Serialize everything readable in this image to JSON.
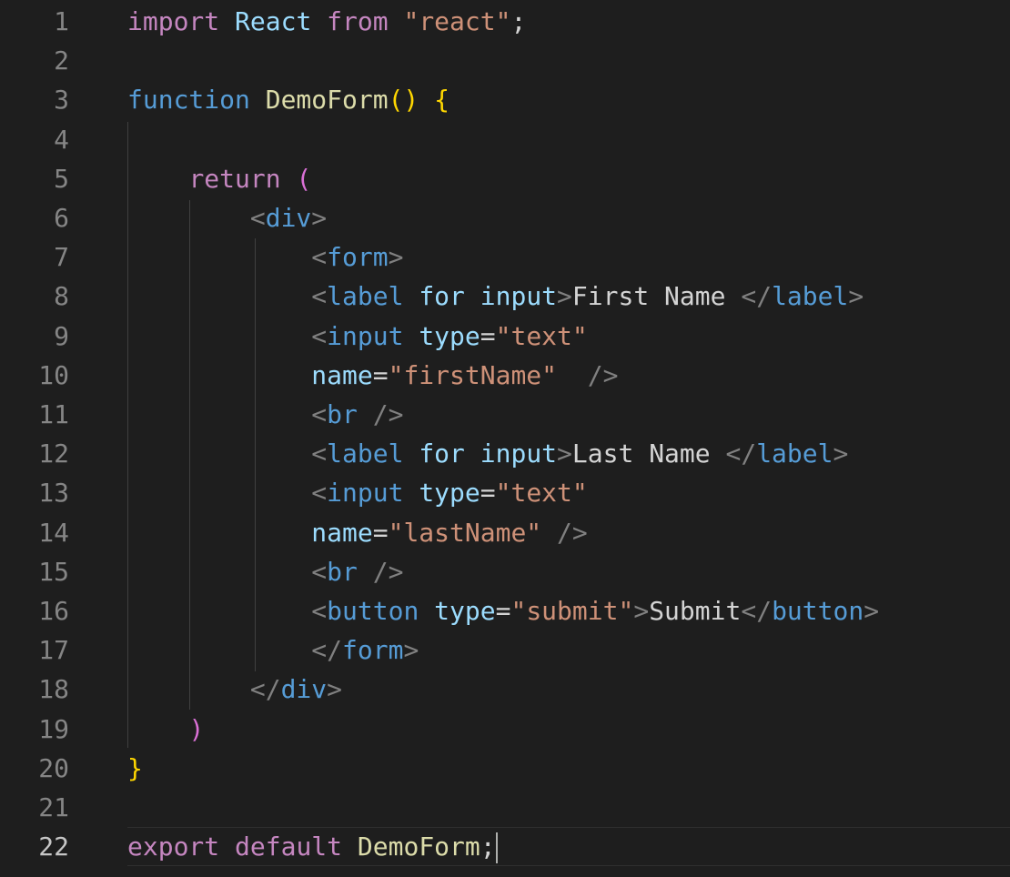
{
  "editor": {
    "current_line": 22,
    "lines": [
      {
        "n": 1,
        "tokens": [
          [
            "kw",
            "import"
          ],
          [
            "pl",
            " "
          ],
          [
            "var",
            "React"
          ],
          [
            "pl",
            " "
          ],
          [
            "kw",
            "from"
          ],
          [
            "pl",
            " "
          ],
          [
            "str",
            "\"react\""
          ],
          [
            "pl",
            ";"
          ]
        ]
      },
      {
        "n": 2,
        "tokens": []
      },
      {
        "n": 3,
        "tokens": [
          [
            "st",
            "function"
          ],
          [
            "pl",
            " "
          ],
          [
            "fn",
            "DemoForm"
          ],
          [
            "br1",
            "()"
          ],
          [
            "pl",
            " "
          ],
          [
            "br1",
            "{"
          ]
        ]
      },
      {
        "n": 4,
        "tokens": []
      },
      {
        "n": 5,
        "tokens": [
          [
            "pl",
            "    "
          ],
          [
            "kw",
            "return"
          ],
          [
            "pl",
            " "
          ],
          [
            "br2",
            "("
          ]
        ]
      },
      {
        "n": 6,
        "tokens": [
          [
            "pl",
            "        "
          ],
          [
            "ang",
            "<"
          ],
          [
            "tag",
            "div"
          ],
          [
            "ang",
            ">"
          ]
        ]
      },
      {
        "n": 7,
        "tokens": [
          [
            "pl",
            "            "
          ],
          [
            "ang",
            "<"
          ],
          [
            "tag",
            "form"
          ],
          [
            "ang",
            ">"
          ]
        ]
      },
      {
        "n": 8,
        "tokens": [
          [
            "pl",
            "            "
          ],
          [
            "ang",
            "<"
          ],
          [
            "tag",
            "label"
          ],
          [
            "pl",
            " "
          ],
          [
            "attr",
            "for"
          ],
          [
            "pl",
            " "
          ],
          [
            "attr",
            "input"
          ],
          [
            "ang",
            ">"
          ],
          [
            "pl",
            "First Name "
          ],
          [
            "ang",
            "</"
          ],
          [
            "tag",
            "label"
          ],
          [
            "ang",
            ">"
          ]
        ]
      },
      {
        "n": 9,
        "tokens": [
          [
            "pl",
            "            "
          ],
          [
            "ang",
            "<"
          ],
          [
            "tag",
            "input"
          ],
          [
            "pl",
            " "
          ],
          [
            "attr",
            "type"
          ],
          [
            "pl",
            "="
          ],
          [
            "str",
            "\"text\""
          ]
        ]
      },
      {
        "n": 10,
        "tokens": [
          [
            "pl",
            "            "
          ],
          [
            "attr",
            "name"
          ],
          [
            "pl",
            "="
          ],
          [
            "str",
            "\"firstName\""
          ],
          [
            "pl",
            "  "
          ],
          [
            "ang",
            "/>"
          ]
        ]
      },
      {
        "n": 11,
        "tokens": [
          [
            "pl",
            "            "
          ],
          [
            "ang",
            "<"
          ],
          [
            "tag",
            "br"
          ],
          [
            "pl",
            " "
          ],
          [
            "ang",
            "/>"
          ]
        ]
      },
      {
        "n": 12,
        "tokens": [
          [
            "pl",
            "            "
          ],
          [
            "ang",
            "<"
          ],
          [
            "tag",
            "label"
          ],
          [
            "pl",
            " "
          ],
          [
            "attr",
            "for"
          ],
          [
            "pl",
            " "
          ],
          [
            "attr",
            "input"
          ],
          [
            "ang",
            ">"
          ],
          [
            "pl",
            "Last Name "
          ],
          [
            "ang",
            "</"
          ],
          [
            "tag",
            "label"
          ],
          [
            "ang",
            ">"
          ]
        ]
      },
      {
        "n": 13,
        "tokens": [
          [
            "pl",
            "            "
          ],
          [
            "ang",
            "<"
          ],
          [
            "tag",
            "input"
          ],
          [
            "pl",
            " "
          ],
          [
            "attr",
            "type"
          ],
          [
            "pl",
            "="
          ],
          [
            "str",
            "\"text\""
          ]
        ]
      },
      {
        "n": 14,
        "tokens": [
          [
            "pl",
            "            "
          ],
          [
            "attr",
            "name"
          ],
          [
            "pl",
            "="
          ],
          [
            "str",
            "\"lastName\""
          ],
          [
            "pl",
            " "
          ],
          [
            "ang",
            "/>"
          ]
        ]
      },
      {
        "n": 15,
        "tokens": [
          [
            "pl",
            "            "
          ],
          [
            "ang",
            "<"
          ],
          [
            "tag",
            "br"
          ],
          [
            "pl",
            " "
          ],
          [
            "ang",
            "/>"
          ]
        ]
      },
      {
        "n": 16,
        "tokens": [
          [
            "pl",
            "            "
          ],
          [
            "ang",
            "<"
          ],
          [
            "tag",
            "button"
          ],
          [
            "pl",
            " "
          ],
          [
            "attr",
            "type"
          ],
          [
            "pl",
            "="
          ],
          [
            "str",
            "\"submit\""
          ],
          [
            "ang",
            ">"
          ],
          [
            "pl",
            "Submit"
          ],
          [
            "ang",
            "</"
          ],
          [
            "tag",
            "button"
          ],
          [
            "ang",
            ">"
          ]
        ]
      },
      {
        "n": 17,
        "tokens": [
          [
            "pl",
            "            "
          ],
          [
            "ang",
            "</"
          ],
          [
            "tag",
            "form"
          ],
          [
            "ang",
            ">"
          ]
        ]
      },
      {
        "n": 18,
        "tokens": [
          [
            "pl",
            "        "
          ],
          [
            "ang",
            "</"
          ],
          [
            "tag",
            "div"
          ],
          [
            "ang",
            ">"
          ]
        ]
      },
      {
        "n": 19,
        "tokens": [
          [
            "pl",
            "    "
          ],
          [
            "br2",
            ")"
          ]
        ]
      },
      {
        "n": 20,
        "tokens": [
          [
            "br1",
            "}"
          ]
        ]
      },
      {
        "n": 21,
        "tokens": []
      },
      {
        "n": 22,
        "tokens": [
          [
            "kw",
            "export"
          ],
          [
            "pl",
            " "
          ],
          [
            "kw",
            "default"
          ],
          [
            "pl",
            " "
          ],
          [
            "fn",
            "DemoForm"
          ],
          [
            "pl",
            ";"
          ]
        ]
      }
    ]
  }
}
